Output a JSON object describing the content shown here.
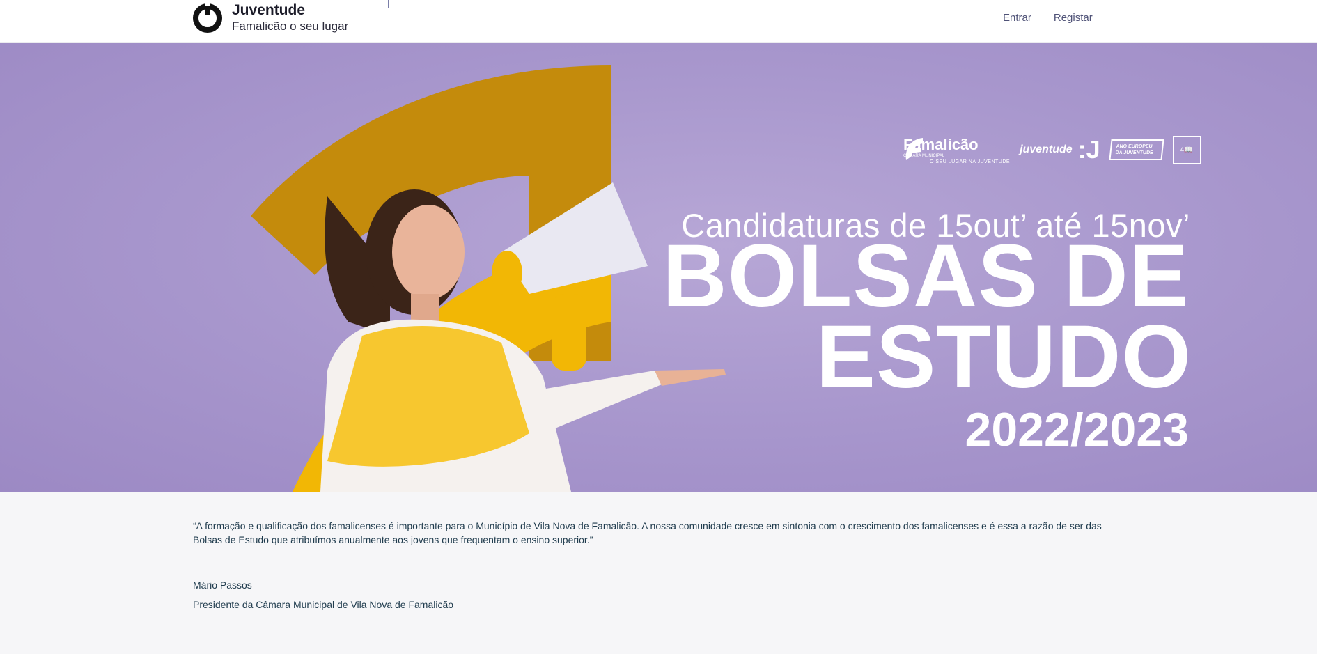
{
  "header": {
    "brand_title": "Juventude",
    "brand_subtitle": "Famalicão o seu lugar",
    "nav": [
      {
        "label": "Entrar"
      },
      {
        "label": "Registar"
      }
    ]
  },
  "banner": {
    "logo_famalicao": "Famalicão",
    "logo_famalicao_sub": "CÂMARA MUNICIPAL",
    "logo_tagline": "O SEU LUGAR NA JUVENTUDE",
    "logo_juventude": "juventude",
    "logo_ano": "ANO EUROPEU DA JUVENTUDE",
    "logo_ods": "4",
    "headline_dates": "Candidaturas de 15out’ até 15nov’",
    "headline_1": "BOLSAS DE",
    "headline_2": "ESTUDO",
    "headline_year": "2022/2023"
  },
  "content": {
    "quote": "“A formação e qualificação dos famalicenses é importante para o Município de Vila Nova de Famalicão.  A nossa comunidade cresce em sintonia com o crescimento dos famalicenses e é essa a razão de ser das Bolsas de Estudo que atribuímos anualmente aos jovens que frequentam o ensino superior.”",
    "author": "Mário Passos",
    "role": "Presidente da Câmara Municipal de Vila Nova de Famalicão"
  },
  "colors": {
    "banner_purple": "#a897cd",
    "accent_yellow": "#f2b705",
    "header_nav": "#4f5277",
    "body_text": "#1f3b4d"
  }
}
